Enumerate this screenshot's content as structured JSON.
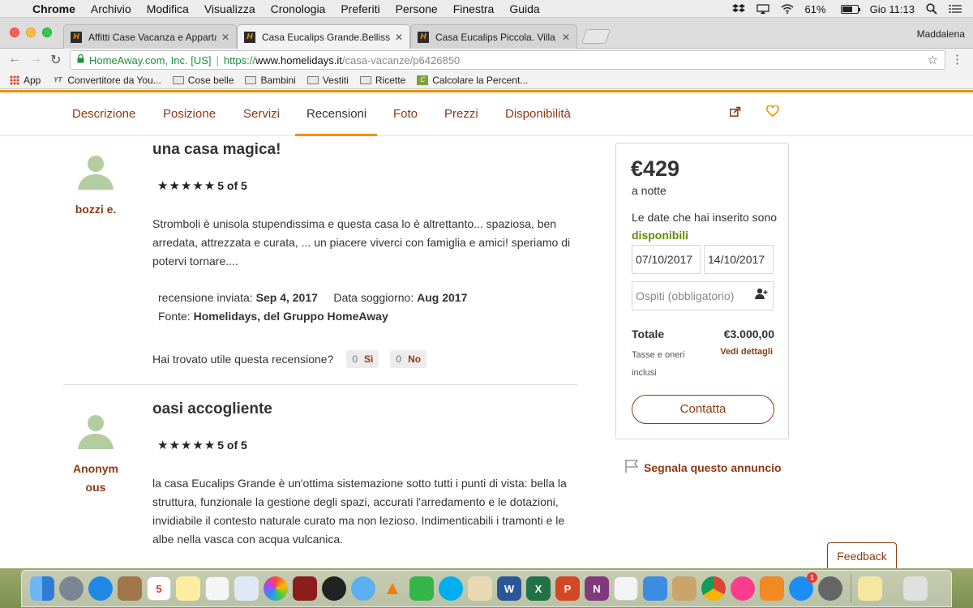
{
  "menubar": {
    "app": "Chrome",
    "items": [
      "Archivio",
      "Modifica",
      "Visualizza",
      "Cronologia",
      "Preferiti",
      "Persone",
      "Finestra",
      "Guida"
    ],
    "battery": "61%",
    "clock": "Gio 11:13"
  },
  "tabs": [
    {
      "title": "Affitti Case Vacanza e Apparta"
    },
    {
      "title": "Casa Eucalips Grande.Bellissim"
    },
    {
      "title": "Casa Eucalips Piccola. Villa con"
    }
  ],
  "tabs_favicon_letter": "H",
  "profile": "Maddalena",
  "address": {
    "org": "HomeAway.com, Inc. [US]",
    "separator": "|",
    "scheme": "https://",
    "host": "www.homelidays.it",
    "path": "/casa-vacanze/p6426850"
  },
  "bookmarks": [
    {
      "label": "App",
      "kind": "apps"
    },
    {
      "label": "Convertitore da You...",
      "kind": "site-yt",
      "badge": "YT"
    },
    {
      "label": "Cose belle",
      "kind": "folder"
    },
    {
      "label": "Bambini",
      "kind": "folder"
    },
    {
      "label": "Vestiti",
      "kind": "folder"
    },
    {
      "label": "Ricette",
      "kind": "folder"
    },
    {
      "label": "Calcolare la Percent...",
      "kind": "site-calc",
      "badge": "C"
    }
  ],
  "subnav": {
    "items": [
      "Descrizione",
      "Posizione",
      "Servizi",
      "Recensioni",
      "Foto",
      "Prezzi",
      "Disponibilità"
    ],
    "active": "Recensioni"
  },
  "reviews": [
    {
      "reviewer": "bozzi e.",
      "title": "una casa magica!",
      "stars": "★★★★★",
      "rating": "5 of 5",
      "body": "Stromboli è unisola stupendissima e questa casa lo è altrettanto... spaziosa, ben arredata, attrezzata e curata, ... un piacere viverci con famiglia e amici! speriamo di potervi tornare....",
      "sent_label": "recensione inviata:",
      "sent_value": "Sep 4, 2017",
      "stay_label": "Data soggiorno:",
      "stay_value": "Aug 2017",
      "source_label": "Fonte:",
      "source_value": "Homelidays, del Gruppo HomeAway",
      "helpful_q": "Hai trovato utile questa recensione?",
      "yes_count": "0",
      "yes_label": "Sì",
      "no_count": "0",
      "no_label": "No"
    },
    {
      "reviewer": "Anonymous",
      "title": "oasi accogliente",
      "stars": "★★★★★",
      "rating": "5 of 5",
      "body": "la casa Eucalips Grande è un'ottima sistemazione sotto tutti i punti di vista: bella la struttura, funzionale la gestione degli spazi, accurati l'arredamento e le dotazioni, invidiabile il contesto naturale curato ma non lezioso. Indimenticabili i tramonti e le albe nella vasca con acqua vulcanica."
    }
  ],
  "booking": {
    "price": "€429",
    "per": "a notte",
    "avail_text": "Le date che hai inserito sono",
    "avail_status": "disponibili",
    "checkin": "07/10/2017",
    "checkout": "14/10/2017",
    "guests_placeholder": "Ospiti (obbligatorio)",
    "total_label": "Totale",
    "total_value": "€3.000,00",
    "taxes": "Tasse e oneri inclusi",
    "details_link": "Vedi dettagli",
    "contact_button": "Contatta"
  },
  "report_link": "Segnala questo annuncio",
  "feedback": "Feedback",
  "dock": {
    "calendar_day": "5",
    "appstore_badge": "1",
    "word_letter": "W",
    "excel_letter": "X",
    "powerpoint_letter": "P",
    "onenote_letter": "N"
  },
  "colors": {
    "brand_orange": "#f39200",
    "link_brown": "#8a3a13",
    "available_green": "#5e8c00"
  }
}
